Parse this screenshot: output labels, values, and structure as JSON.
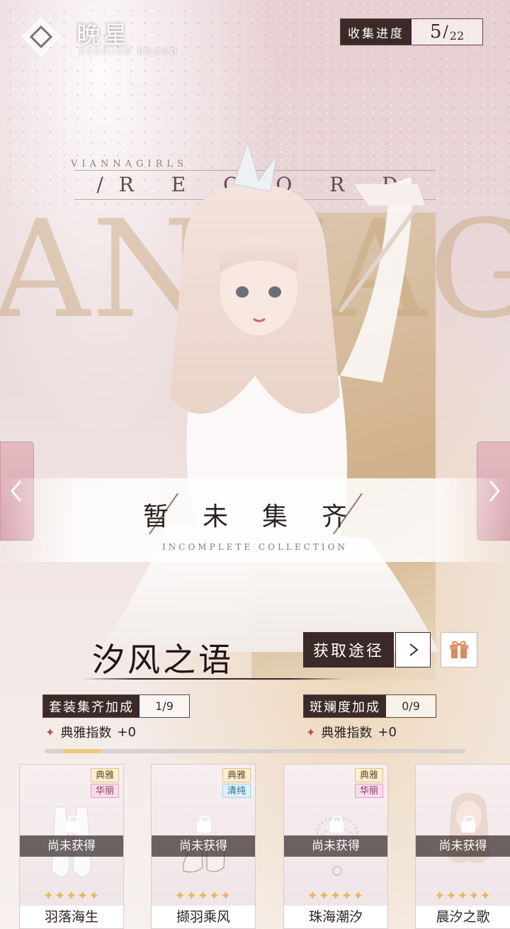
{
  "header": {
    "brand_title": "晚星",
    "brand_subtitle": "FASHION BRAND",
    "progress_label": "收集进度",
    "progress_current": "5",
    "progress_total": "22"
  },
  "background": {
    "record_caption": "VIANNAGIRLS",
    "record_text": "/R E C O R D S",
    "big_word": "ANNAGIR"
  },
  "banner": {
    "title": "暂未集齐",
    "subtitle": "INCOMPLETE    COLLECTION"
  },
  "suit": {
    "name": "汐风之语",
    "obtain_label": "获取途径"
  },
  "stats": {
    "set_bonus_label": "套装集齐加成",
    "set_bonus_value": "1/9",
    "bonus_attr_1": "典雅指数",
    "bonus_value_1": "+0",
    "spot_label": "斑斓度加成",
    "spot_value": "0/9",
    "bonus_attr_2": "典雅指数",
    "bonus_value_2": "+0"
  },
  "items": [
    {
      "name": "羽落海生",
      "tag1": "典雅",
      "tag2": "华丽",
      "status": "尚未获得",
      "stars": "✦✦✦✦✦"
    },
    {
      "name": "撷羽乘风",
      "tag1": "典雅",
      "tag2": "清纯",
      "status": "尚未获得",
      "stars": "✦✦✦✦✦"
    },
    {
      "name": "珠海潮汐",
      "tag1": "典雅",
      "tag2": "华丽",
      "status": "尚未获得",
      "stars": "✦✦✦✦✦"
    },
    {
      "name": "晨汐之歌",
      "status": "尚未获得",
      "stars": "✦✦✦✦✦"
    }
  ],
  "colors": {
    "dark_accent": "#3b2a28",
    "gold_star": "#e8b85a",
    "side_arrow": "#d8a8b0"
  }
}
